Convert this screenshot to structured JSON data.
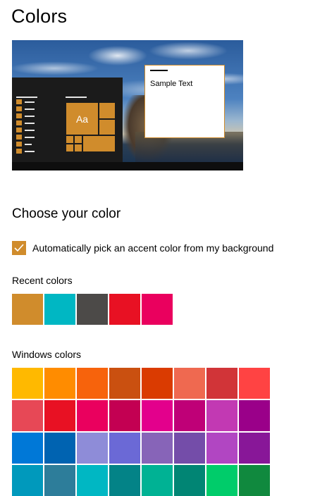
{
  "page_title": "Colors",
  "preview": {
    "sample_text": "Sample Text",
    "tile_text": "Aa",
    "accent_color": "#D08C2C"
  },
  "choose_section": {
    "title": "Choose your color",
    "auto_pick_label": "Automatically pick an accent color from my background",
    "auto_pick_checked": true
  },
  "recent_colors": {
    "label": "Recent colors",
    "swatches": [
      "#D08C2C",
      "#00B7C3",
      "#4C4A48",
      "#E81123",
      "#EA005E"
    ]
  },
  "windows_colors": {
    "label": "Windows colors",
    "swatches": [
      "#FFB900",
      "#FF8C00",
      "#F7630C",
      "#CA5010",
      "#DA3B01",
      "#EF6950",
      "#D13438",
      "#FF4343",
      "#E74856",
      "#E81123",
      "#EA005E",
      "#C30052",
      "#E3008C",
      "#BF0077",
      "#C239B3",
      "#9A0089",
      "#0078D7",
      "#0063B1",
      "#8E8CD8",
      "#6B69D6",
      "#8764B8",
      "#744DA9",
      "#B146C2",
      "#881798",
      "#0099BC",
      "#2D7D9A",
      "#00B7C3",
      "#038387",
      "#00B294",
      "#018574",
      "#00CC6A",
      "#10893E"
    ]
  }
}
